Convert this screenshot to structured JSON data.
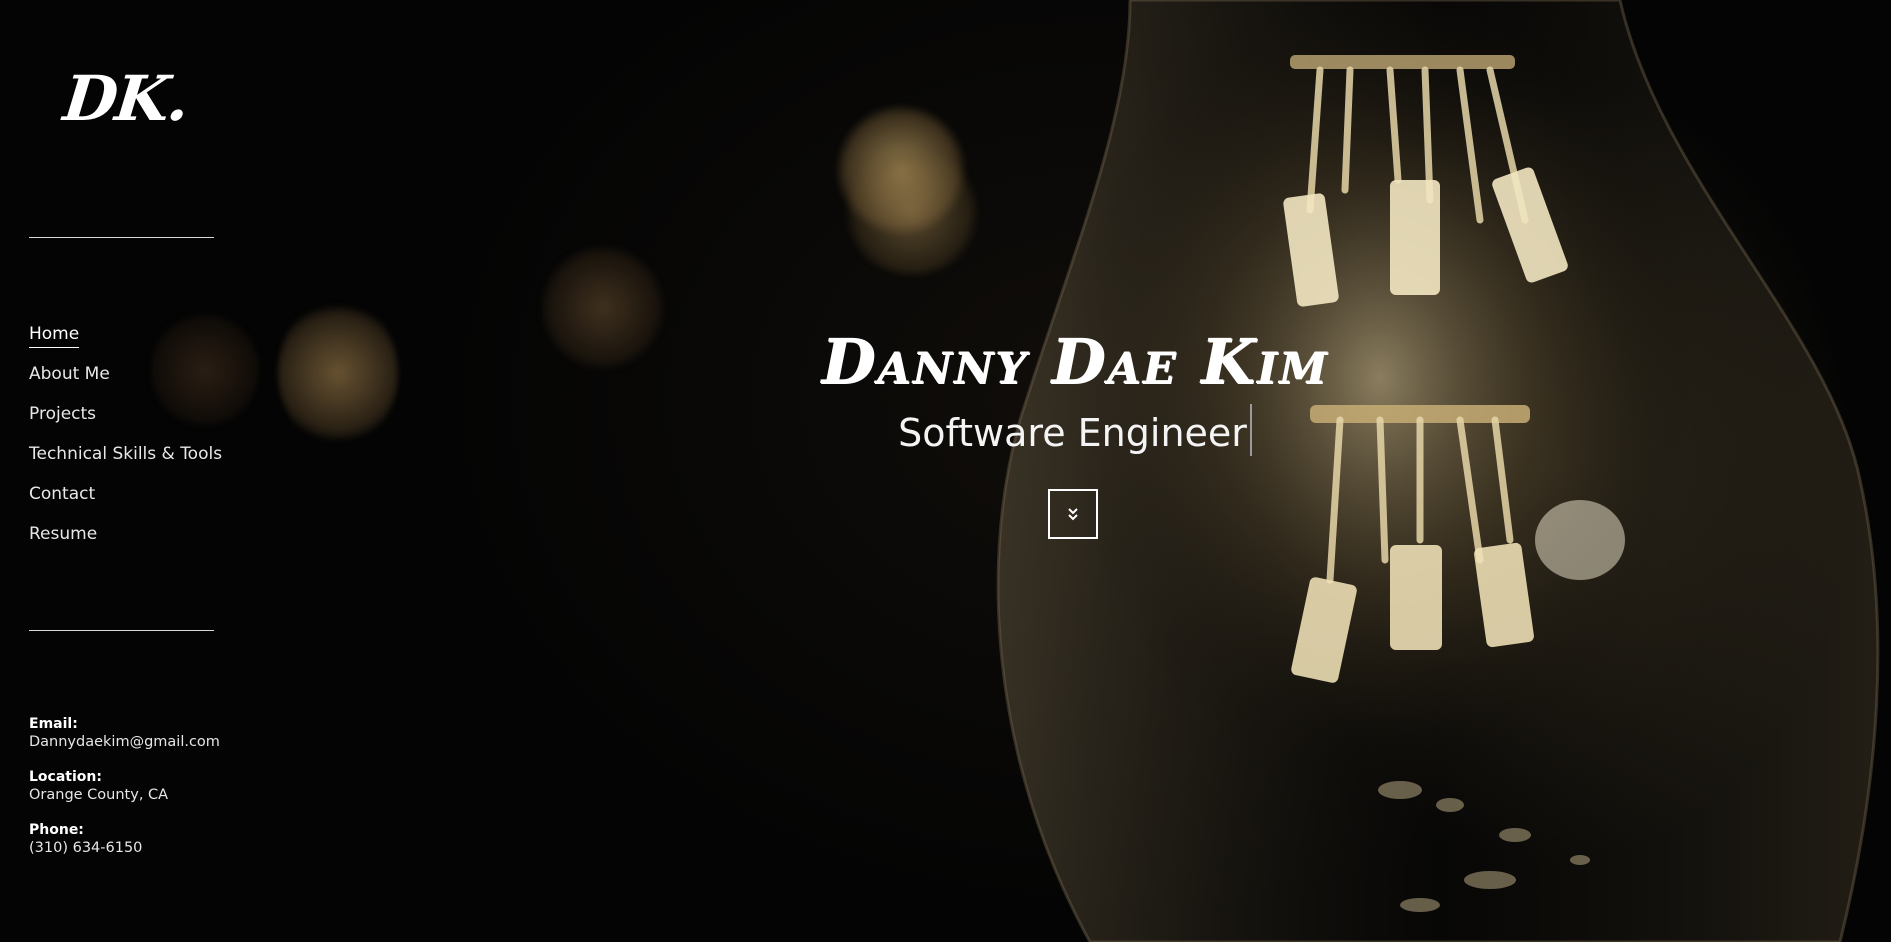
{
  "brand": {
    "logo_text": "DK."
  },
  "nav": {
    "items": [
      {
        "label": "Home",
        "active": true
      },
      {
        "label": "About Me",
        "active": false
      },
      {
        "label": "Projects",
        "active": false
      },
      {
        "label": "Technical Skills & Tools",
        "active": false
      },
      {
        "label": "Contact",
        "active": false
      },
      {
        "label": "Resume",
        "active": false
      }
    ]
  },
  "contact": {
    "email_label": "Email:",
    "email": "Dannydaekim@gmail.com",
    "location_label": "Location:",
    "location": "Orange County, CA",
    "phone_label": "Phone:",
    "phone": "(310) 634-6150"
  },
  "hero": {
    "name": "Danny Dae Kim",
    "role": "Software Engineer",
    "scroll_icon": "double-chevron-down-icon"
  },
  "colors": {
    "background": "#040404",
    "text": "#ffffff",
    "bulb_glow": "#d9c08a"
  }
}
